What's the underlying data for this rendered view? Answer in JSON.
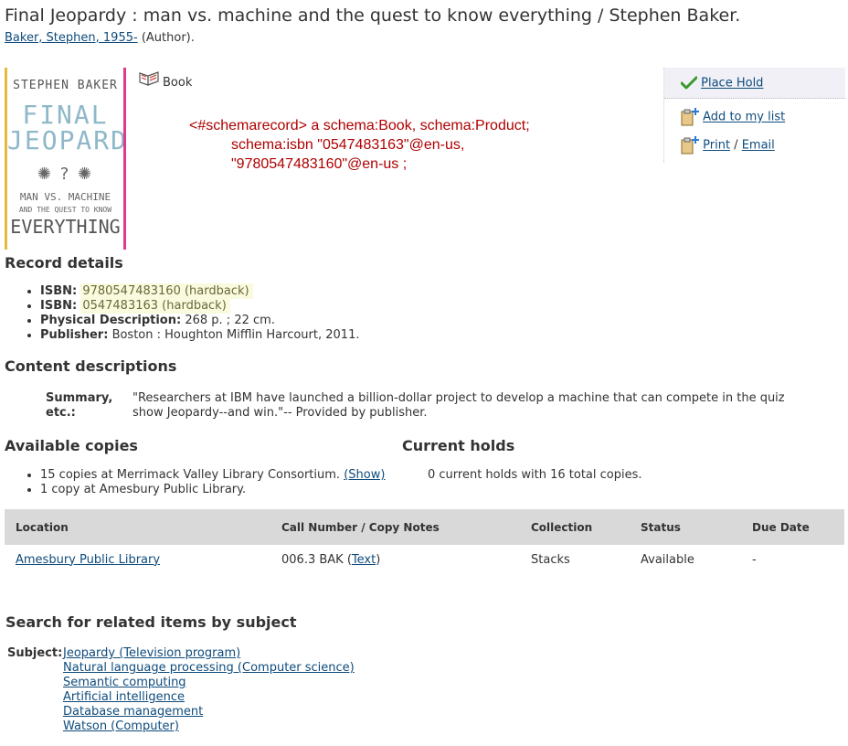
{
  "record": {
    "title": "Final Jeopardy : man vs. machine and the quest to know everything / Stephen Baker.",
    "author_link": "Baker, Stephen, 1955-",
    "author_role": " (Author).",
    "format": "Book",
    "cover": {
      "author": "STEPHEN BAKER",
      "title_line1": "FINAL",
      "title_line2": "JEOPARDY",
      "subtitle_line1": "MAN VS. MACHINE",
      "subtitle_line2": "AND THE QUEST TO KNOW",
      "subtitle_line3": "EVERYTHING"
    }
  },
  "schema_text": [
    "<#schemarecord> a schema:Book, schema:Product;",
    "schema:isbn \"0547483163\"@en-us,",
    "\"9780547483160\"@en-us ;"
  ],
  "actions": {
    "place_hold": "Place Hold",
    "add_to_list": "Add to my list",
    "print": "Print",
    "separator": " / ",
    "email": "Email"
  },
  "record_details": {
    "heading": "Record details",
    "items": [
      {
        "label": "ISBN:",
        "value": "9780547483160 (hardback)"
      },
      {
        "label": "ISBN:",
        "value": "0547483163 (hardback)"
      },
      {
        "label": "Physical Description:",
        "value": "268 p. ; 22 cm."
      },
      {
        "label": "Publisher:",
        "value": "Boston : Houghton Mifflin Harcourt, 2011."
      }
    ]
  },
  "content": {
    "heading": "Content descriptions",
    "summary_label": "Summary, etc.:",
    "summary_text": "\"Researchers at IBM have launched a billion-dollar project to develop a machine that can compete in the quiz show Jeopardy--and win.\"-- Provided by publisher."
  },
  "copies": {
    "heading": "Available copies",
    "line1": "15 copies at Merrimack Valley Library Consortium.",
    "show_link": "(Show)",
    "line2": "1 copy at Amesbury Public Library."
  },
  "holds": {
    "heading": "Current holds",
    "text": "0 current holds with 16 total copies."
  },
  "table": {
    "headers": [
      "Location",
      "Call Number / Copy Notes",
      "Collection",
      "Status",
      "Due Date"
    ],
    "row": {
      "location": "Amesbury Public Library",
      "call_number": "006.3 BAK (",
      "call_link": "Text",
      "call_close": ")",
      "collection": "Stacks",
      "status": "Available",
      "due": "-"
    }
  },
  "related": {
    "heading": "Search for related items by subject",
    "label": "Subject:",
    "subjects": [
      "Jeopardy (Television program)",
      "Natural language processing (Computer science)",
      "Semantic computing",
      "Artificial intelligence",
      "Database management",
      "Watson (Computer)"
    ]
  }
}
